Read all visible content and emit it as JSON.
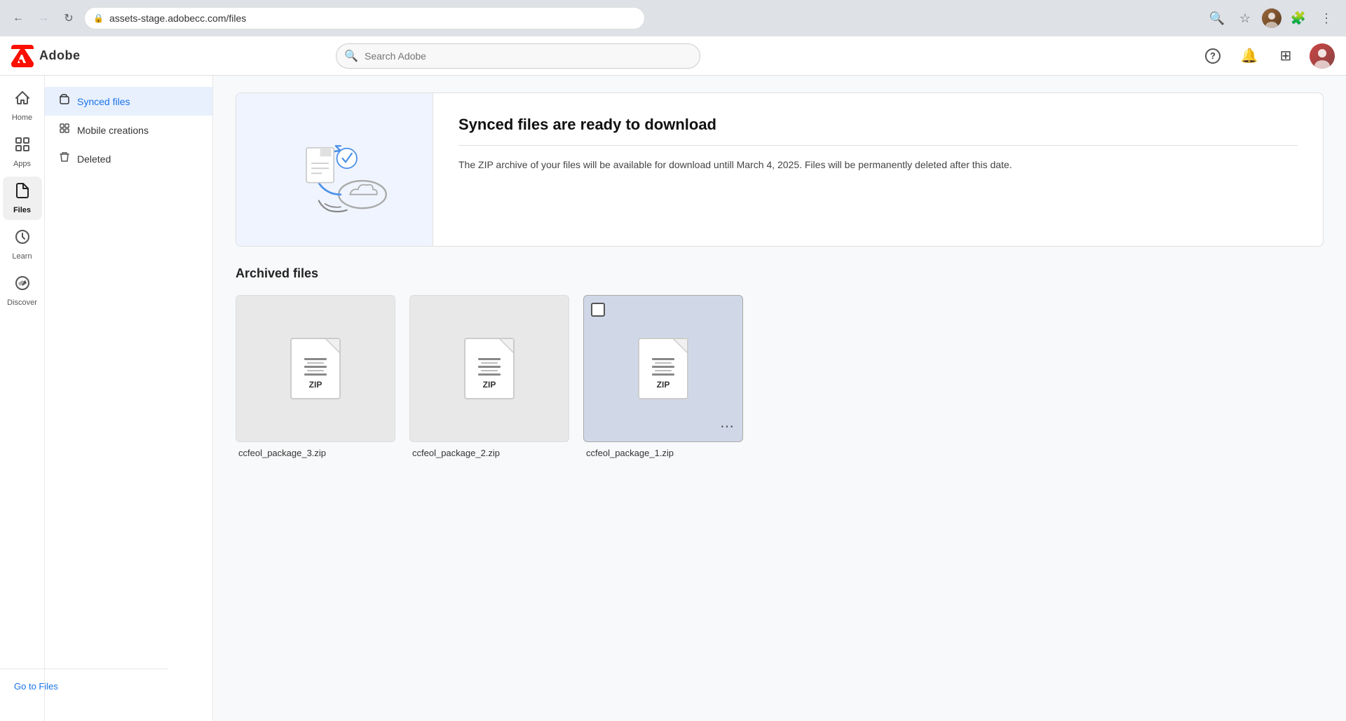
{
  "browser": {
    "url": "assets-stage.adobecc.com/files",
    "back_disabled": false,
    "forward_disabled": true
  },
  "topnav": {
    "adobe_text": "Adobe",
    "search_placeholder": "Search Adobe",
    "help_icon": "?",
    "bell_icon": "🔔",
    "grid_icon": "⊞"
  },
  "sidebar": {
    "items": [
      {
        "id": "home",
        "label": "Home",
        "icon": "⌂",
        "active": false
      },
      {
        "id": "apps",
        "label": "Apps",
        "icon": "⊞",
        "active": false
      },
      {
        "id": "files",
        "label": "Files",
        "icon": "📄",
        "active": true
      },
      {
        "id": "learn",
        "label": "Learn",
        "icon": "💡",
        "active": false
      },
      {
        "id": "discover",
        "label": "Discover",
        "icon": "🔍",
        "active": false
      }
    ]
  },
  "nav_sidebar": {
    "items": [
      {
        "id": "synced-files",
        "label": "Synced files",
        "icon": "📄",
        "active": true
      },
      {
        "id": "mobile-creations",
        "label": "Mobile creations",
        "icon": "⊞",
        "active": false
      },
      {
        "id": "deleted",
        "label": "Deleted",
        "icon": "🗑",
        "active": false
      }
    ],
    "bottom_link": "Go to Files"
  },
  "banner": {
    "title": "Synced files are ready to download",
    "divider": true,
    "text": "The ZIP archive of your files will be available for download untill March 4, 2025. Files will be permanently deleted after this date."
  },
  "archived_files": {
    "section_title": "Archived files",
    "files": [
      {
        "id": 1,
        "name": "ccfeol_package_3.zip",
        "has_checkbox": false,
        "has_more": false,
        "selected": false
      },
      {
        "id": 2,
        "name": "ccfeol_package_2.zip",
        "has_checkbox": false,
        "has_more": false,
        "selected": false
      },
      {
        "id": 3,
        "name": "ccfeol_package_1.zip",
        "has_checkbox": true,
        "has_more": true,
        "selected": true
      }
    ]
  }
}
